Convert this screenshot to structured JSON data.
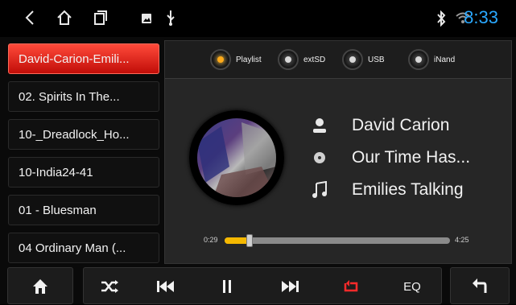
{
  "status_bar": {
    "time": "8:33",
    "icons": [
      "back-icon",
      "home-icon",
      "recent-apps-icon",
      "gallery-icon",
      "usb-icon",
      "bluetooth-icon",
      "wifi-icon"
    ]
  },
  "playlist": {
    "items": [
      {
        "label": "David-Carion-Emili...",
        "active": true
      },
      {
        "label": "02. Spirits In The...",
        "active": false
      },
      {
        "label": "10-_Dreadlock_Ho...",
        "active": false
      },
      {
        "label": "10-India24-41",
        "active": false
      },
      {
        "label": "01 - Bluesman",
        "active": false
      },
      {
        "label": "04 Ordinary Man (...",
        "active": false
      }
    ]
  },
  "sources": [
    {
      "label": "Playlist",
      "active": true
    },
    {
      "label": "extSD",
      "active": false
    },
    {
      "label": "USB",
      "active": false
    },
    {
      "label": "iNand",
      "active": false
    }
  ],
  "now_playing": {
    "artist": "David Carion",
    "album": "Our Time Has...",
    "title": "Emilies Talking",
    "elapsed": "0:29",
    "duration": "4:25",
    "progress_fraction": 0.11
  },
  "controls": {
    "eq_label": "EQ"
  },
  "colors": {
    "accent": "#2aa8ff",
    "active_track": "#d5120c",
    "progress": "#f5b800",
    "repeat": "#ff2a2a"
  }
}
